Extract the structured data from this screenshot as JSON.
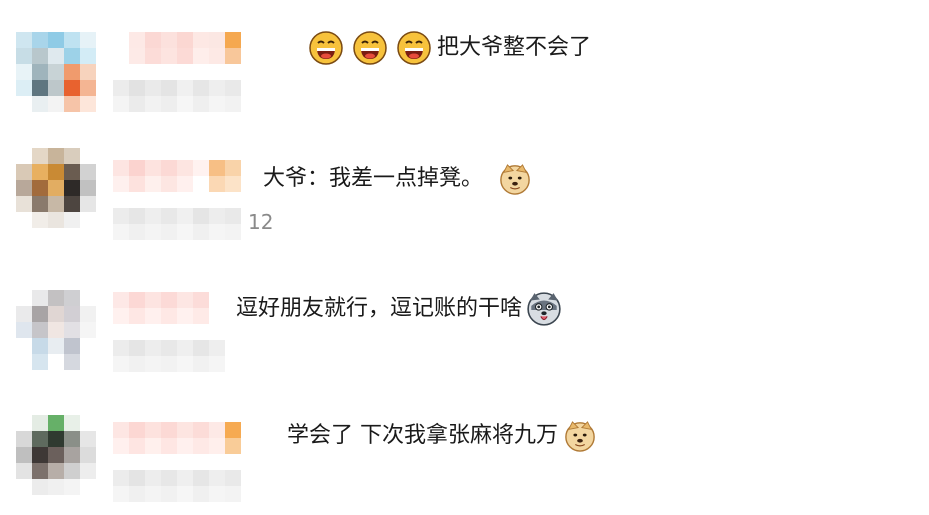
{
  "comments": [
    {
      "text": "把大爷整不会了",
      "emojis": [
        "laughing-face-icon",
        "laughing-face-icon",
        "laughing-face-icon"
      ],
      "trailing_emoji": ""
    },
    {
      "text": "大爷：我差一点掉凳。",
      "trailing_emoji": "doge-icon",
      "count": "12"
    },
    {
      "text": "逗好朋友就行，逗记账的干啥",
      "trailing_emoji": "husky-icon"
    },
    {
      "text": "学会了 下次我拿张麻将九万",
      "trailing_emoji": "doge-icon"
    }
  ]
}
